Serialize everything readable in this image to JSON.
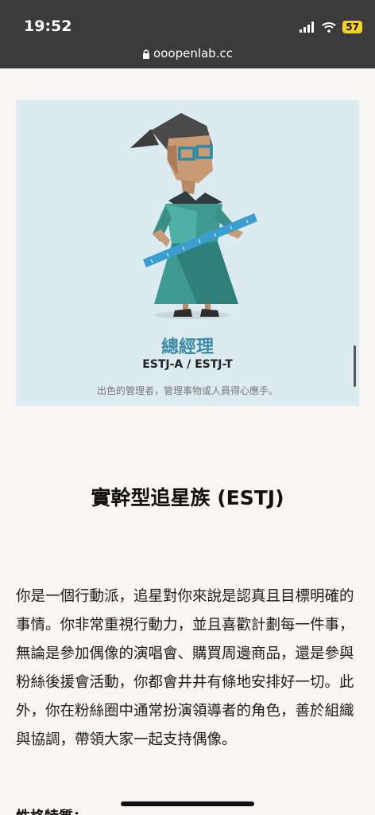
{
  "status_bar": {
    "time": "19:52",
    "battery": "57"
  },
  "browser": {
    "url": "ooopenlab.cc"
  },
  "hero": {
    "role": "總經理",
    "code": "ESTJ-A / ESTJ-T",
    "description": "出色的管理者，管理事物或人員得心應手。"
  },
  "article": {
    "title": "實幹型追星族 (ESTJ)",
    "body": "你是一個行動派，追星對你來說是認真且目標明確的事情。你非常重視行動力，並且喜歡計劃每一件事，無論是參加偶像的演唱會、購買周邊商品，還是參與粉絲後援會活動，你都會井井有條地安排好一切。此外，你在粉絲圈中通常扮演領導者的角色，善於組織與協調，帶領大家一起支持偶像。",
    "next_heading": "性格特質："
  }
}
